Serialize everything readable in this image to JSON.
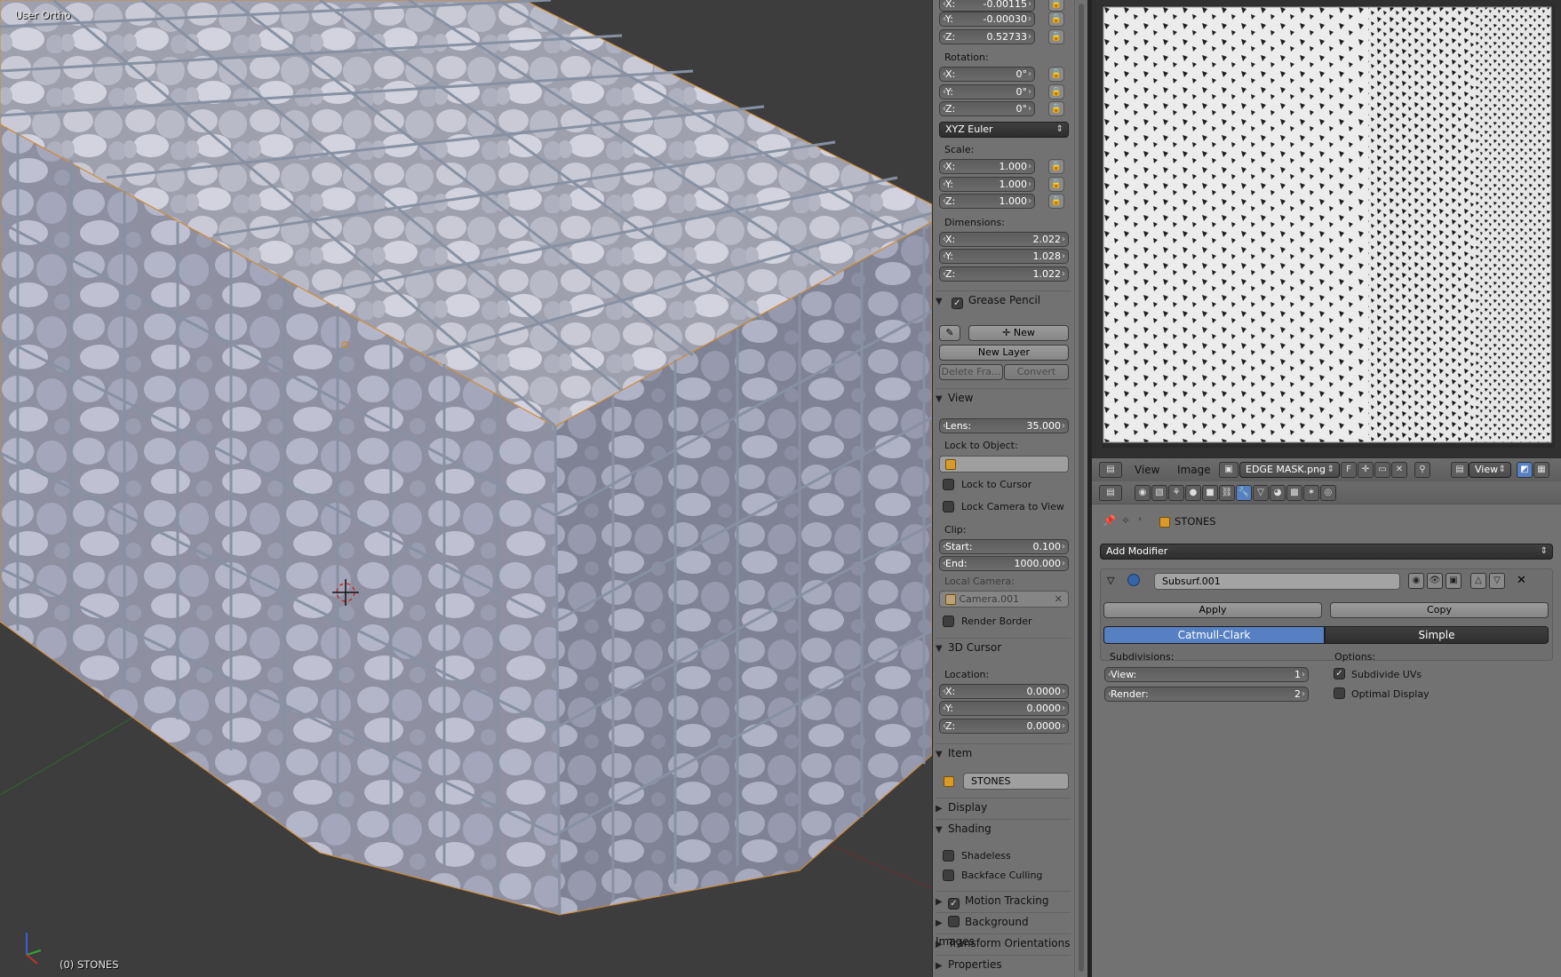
{
  "viewport": {
    "mode_label": "User Ortho",
    "object_label": "(0) STONES"
  },
  "npanel": {
    "location": {
      "x": "-0.00115",
      "y": "-0.00030",
      "z": "0.52733"
    },
    "rotation": {
      "label": "Rotation:",
      "x": "0°",
      "y": "0°",
      "z": "0°",
      "mode": "XYZ Euler"
    },
    "scale": {
      "label": "Scale:",
      "x": "1.000",
      "y": "1.000",
      "z": "1.000"
    },
    "dimensions": {
      "label": "Dimensions:",
      "x": "2.022",
      "y": "1.028",
      "z": "1.022"
    },
    "axis": {
      "x": "X:",
      "y": "Y:",
      "z": "Z:"
    },
    "grease_pencil": {
      "title": "Grease Pencil",
      "new_label": "New",
      "new_layer_label": "New Layer",
      "delete_frame_label": "Delete Fra...",
      "convert_label": "Convert"
    },
    "view": {
      "title": "View",
      "lens_key": "Lens:",
      "lens_value": "35.000",
      "lock_to_object": "Lock to Object:",
      "lock_to_cursor": "Lock to Cursor",
      "lock_camera_to_view": "Lock Camera to View",
      "clip": "Clip:",
      "start_key": "Start:",
      "start_value": "0.100",
      "end_key": "End:",
      "end_value": "1000.000",
      "local_camera": "Local Camera:",
      "camera_name": "Camera.001",
      "render_border": "Render Border"
    },
    "cursor": {
      "title": "3D Cursor",
      "location": "Location:",
      "x": "0.0000",
      "y": "0.0000",
      "z": "0.0000"
    },
    "item": {
      "title": "Item",
      "name": "STONES"
    },
    "display": {
      "title": "Display"
    },
    "shading": {
      "title": "Shading",
      "shadeless": "Shadeless",
      "backface_culling": "Backface Culling"
    },
    "motion_tracking": {
      "title": "Motion Tracking"
    },
    "background_images": {
      "title": "Background Images"
    },
    "transform_orientations": {
      "title": "Transform Orientations"
    },
    "properties": {
      "title": "Properties"
    }
  },
  "image_editor": {
    "menu_view": "View",
    "menu_image": "Image",
    "image_name": "EDGE MASK.png",
    "fake_user": "F",
    "view_select": "View"
  },
  "properties": {
    "object_name": "STONES",
    "add_modifier": "Add Modifier",
    "modifier_name": "Subsurf.001",
    "apply": "Apply",
    "copy": "Copy",
    "tab_catmull": "Catmull-Clark",
    "tab_simple": "Simple",
    "subdivisions": "Subdivisions:",
    "view_key": "View:",
    "view_value": "1",
    "render_key": "Render:",
    "render_value": "2",
    "options": "Options:",
    "subdivide_uvs": "Subdivide UVs",
    "optimal_display": "Optimal Display"
  },
  "colors": {
    "accent": "#5680c2",
    "panel": "#727272",
    "viewport_bg": "#3d3d3d",
    "mesh": "#b8b8c8",
    "wire": "#8a96a8"
  }
}
